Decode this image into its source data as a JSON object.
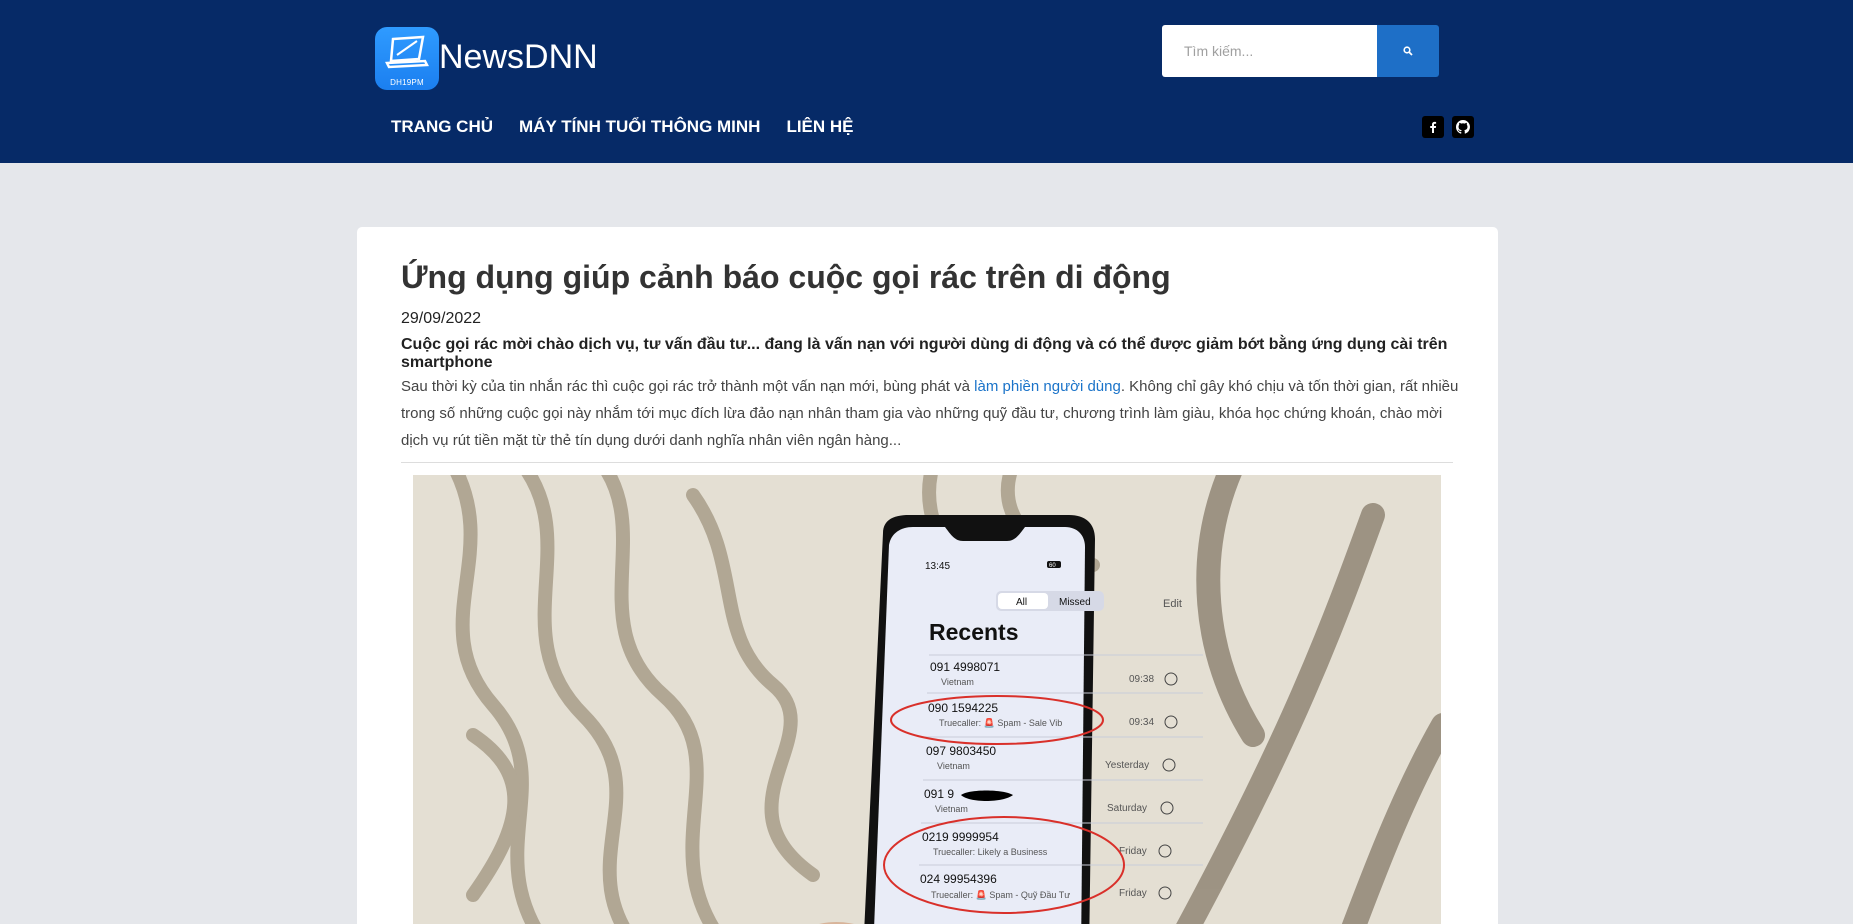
{
  "header": {
    "brand": "NewsDNN",
    "logo_caption": "DH19PM",
    "search": {
      "placeholder": "Tìm kiếm..."
    },
    "nav": [
      {
        "label": "TRANG CHỦ"
      },
      {
        "label": "MÁY TÍNH TUỔI THÔNG MINH"
      },
      {
        "label": "LIÊN HỆ"
      }
    ],
    "social": [
      {
        "icon": "facebook-icon"
      },
      {
        "icon": "github-icon"
      }
    ]
  },
  "article": {
    "title": "Ứng dụng giúp cảnh báo cuộc gọi rác trên di động",
    "date": "29/09/2022",
    "lead": "Cuộc gọi rác mời chào dịch vụ, tư vấn đầu tư... đang là vấn nạn với người dùng di động và có thể được giảm bớt bằng ứng dụng cài trên smartphone",
    "body_before_link": "Sau thời kỳ của tin nhắn rác thì cuộc gọi rác trở thành một vấn nạn mới, bùng phát và ",
    "body_link": "làm phiền người dùng",
    "body_after_link": ". Không chỉ gây khó chịu và tốn thời gian, rất nhiều trong số những cuộc gọi này nhắm tới mục đích lừa đảo nạn nhân tham gia vào những quỹ đầu tư, chương trình làm giàu, khóa học chứng khoán, chào mời dịch vụ rút tiền mặt từ thẻ tín dụng dưới danh nghĩa nhân viên ngân hàng..."
  },
  "phone": {
    "time": "13:45",
    "battery": "60",
    "tab_all": "All",
    "tab_missed": "Missed",
    "edit": "Edit",
    "heading": "Recents",
    "calls": [
      {
        "number": "091 4998071",
        "sub": "Vietnam",
        "time": "09:38"
      },
      {
        "number": "090 1594225",
        "sub": "Truecaller: 🚨 Spam - Sale Vib",
        "time": "09:34"
      },
      {
        "number": "097 9803450",
        "sub": "Vietnam",
        "time": "Yesterday"
      },
      {
        "number": "091 9",
        "sub": "Vietnam",
        "time": "Saturday"
      },
      {
        "number": "0219 9999954",
        "sub": "Truecaller: Likely a Business",
        "time": "Friday"
      },
      {
        "number": "024 99954396",
        "sub": "Truecaller: 🚨 Spam - Quỹ Đầu Tư",
        "time": "Friday"
      }
    ]
  },
  "colors": {
    "header_bg": "#062a67",
    "search_button": "#1e6fc7",
    "link": "#1a73c9",
    "page_bg": "#e5e7eb"
  }
}
